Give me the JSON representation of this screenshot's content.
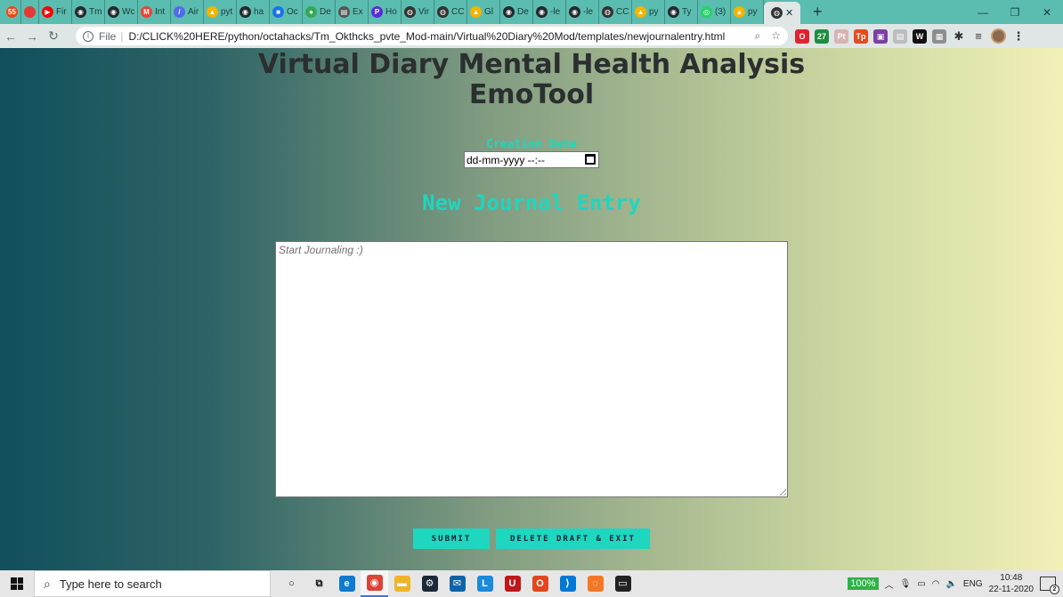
{
  "browser": {
    "tabs": [
      {
        "title": "",
        "badge": "55",
        "color": "#e64a19"
      },
      {
        "title": "",
        "color": "#e53935"
      },
      {
        "title": "Fir",
        "color": "#ff0000",
        "glyph": "▶"
      },
      {
        "title": "Tm",
        "color": "#24292e",
        "glyph": "◉"
      },
      {
        "title": "Wc",
        "color": "#24292e",
        "glyph": "◉"
      },
      {
        "title": "Int",
        "color": "#ea4335",
        "glyph": "M"
      },
      {
        "title": "Air",
        "color": "#4f6bed",
        "glyph": "/"
      },
      {
        "title": "pyt",
        "color": "#f4b400",
        "glyph": "▲"
      },
      {
        "title": "ha",
        "color": "#24292e",
        "glyph": "◉"
      },
      {
        "title": "Oc",
        "color": "#1a73e8",
        "glyph": "■"
      },
      {
        "title": "De",
        "color": "#34a853",
        "glyph": "●"
      },
      {
        "title": "Ex",
        "color": "#555555",
        "glyph": "▤"
      },
      {
        "title": "Ho",
        "color": "#5b2bd9",
        "glyph": "P"
      },
      {
        "title": "Vir",
        "color": "#333333",
        "glyph": "◍"
      },
      {
        "title": "CC",
        "color": "#333333",
        "glyph": "◍"
      },
      {
        "title": "Gl",
        "color": "#f4b400",
        "glyph": "▲"
      },
      {
        "title": "De",
        "color": "#24292e",
        "glyph": "◉"
      },
      {
        "title": "-le",
        "color": "#24292e",
        "glyph": "◉"
      },
      {
        "title": "-le",
        "color": "#24292e",
        "glyph": "◉"
      },
      {
        "title": "CC",
        "color": "#333333",
        "glyph": "◍"
      },
      {
        "title": "py",
        "color": "#f4b400",
        "glyph": "▲"
      },
      {
        "title": "Ty",
        "color": "#24292e",
        "glyph": "◉"
      },
      {
        "title": "(3)",
        "color": "#25d366",
        "glyph": "◎"
      },
      {
        "title": "py",
        "color": "#f4b400",
        "glyph": "▲"
      }
    ],
    "active_tab_glyph": "◍",
    "close_glyph": "✕",
    "newtab_glyph": "+",
    "window_controls": {
      "minimize": "—",
      "restore": "❐",
      "close": "✕"
    },
    "address": {
      "scheme": "File",
      "url": "D:/CLICK%20HERE/python/octahacks/Tm_Okthcks_pvte_Mod-main/Virtual%20Diary%20Mod/templates/newjournalentry.html"
    },
    "extensions": [
      {
        "name": "opera-icon",
        "glyph": "O",
        "color": "#e0242f"
      },
      {
        "name": "calendar-ext-icon",
        "glyph": "27",
        "color": "#1e8e3e"
      },
      {
        "name": "pinterest-ext-icon",
        "glyph": "Pt",
        "color": "#d8b3b3"
      },
      {
        "name": "tp-ext-icon",
        "glyph": "Tp",
        "color": "#e24c1f"
      },
      {
        "name": "save-ext-icon",
        "glyph": "▣",
        "color": "#7b3fa0"
      },
      {
        "name": "grey-ext-icon",
        "glyph": "▤",
        "color": "#bdbdbd"
      },
      {
        "name": "mw-ext-icon",
        "glyph": "W",
        "color": "#111111"
      },
      {
        "name": "box-ext-icon",
        "glyph": "▦",
        "color": "#8e8e8e"
      }
    ]
  },
  "page": {
    "title_line1": "Virtual Diary Mental Health Analysis",
    "title_line2": "EmoTool",
    "date_label": "Creation Date",
    "date_value": "dd-mm-yyyy --:--",
    "entry_heading": "New Journal Entry",
    "journal_placeholder": "Start Journaling :)",
    "submit_label": "SUBMIT",
    "delete_label": "DELETE DRAFT & EXIT"
  },
  "taskbar": {
    "search_placeholder": "Type here to search",
    "apps": [
      {
        "name": "cortana-icon",
        "glyph": "○",
        "color": "transparent",
        "text": "#111"
      },
      {
        "name": "task-view-icon",
        "glyph": "⧉",
        "color": "transparent",
        "text": "#111"
      },
      {
        "name": "edge-icon",
        "glyph": "e",
        "color": "#0c7bd0"
      },
      {
        "name": "chrome-icon",
        "glyph": "◉",
        "color": "#db4437",
        "active": true
      },
      {
        "name": "file-explorer-icon",
        "glyph": "▬",
        "color": "#f0b429"
      },
      {
        "name": "steam-icon",
        "glyph": "⚙",
        "color": "#1b2838"
      },
      {
        "name": "mail-icon",
        "glyph": "✉",
        "color": "#0a64ad"
      },
      {
        "name": "l-app-icon",
        "glyph": "L",
        "color": "#1c8adb"
      },
      {
        "name": "mcafee-icon",
        "glyph": "U",
        "color": "#c01818"
      },
      {
        "name": "office-icon",
        "glyph": "O",
        "color": "#e3461e"
      },
      {
        "name": "vscode-icon",
        "glyph": "⟩",
        "color": "#0078d7"
      },
      {
        "name": "jupyter-icon",
        "glyph": "◌",
        "color": "#f37726"
      },
      {
        "name": "terminal-icon",
        "glyph": "▭",
        "color": "#222222"
      }
    ],
    "battery": "100%",
    "language": "ENG",
    "time": "10:48",
    "date": "22-11-2020",
    "notifications": "2"
  }
}
